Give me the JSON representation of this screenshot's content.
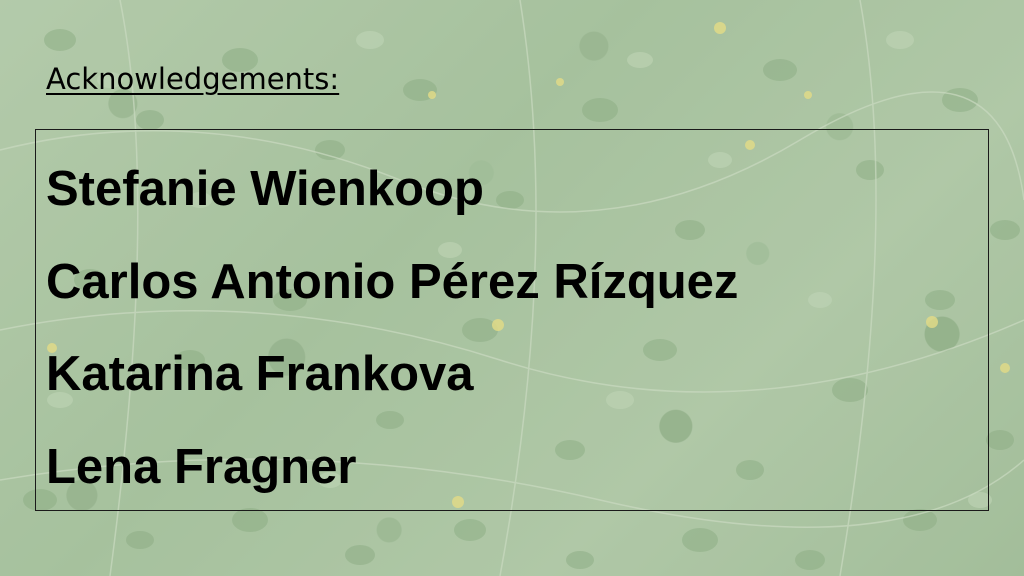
{
  "slide": {
    "heading": "Acknowledgements:",
    "names": [
      "Stefanie Wienkoop",
      "Carlos Antonio Pérez Rízquez",
      "Katarina Frankova",
      "Lena Fragner"
    ]
  }
}
